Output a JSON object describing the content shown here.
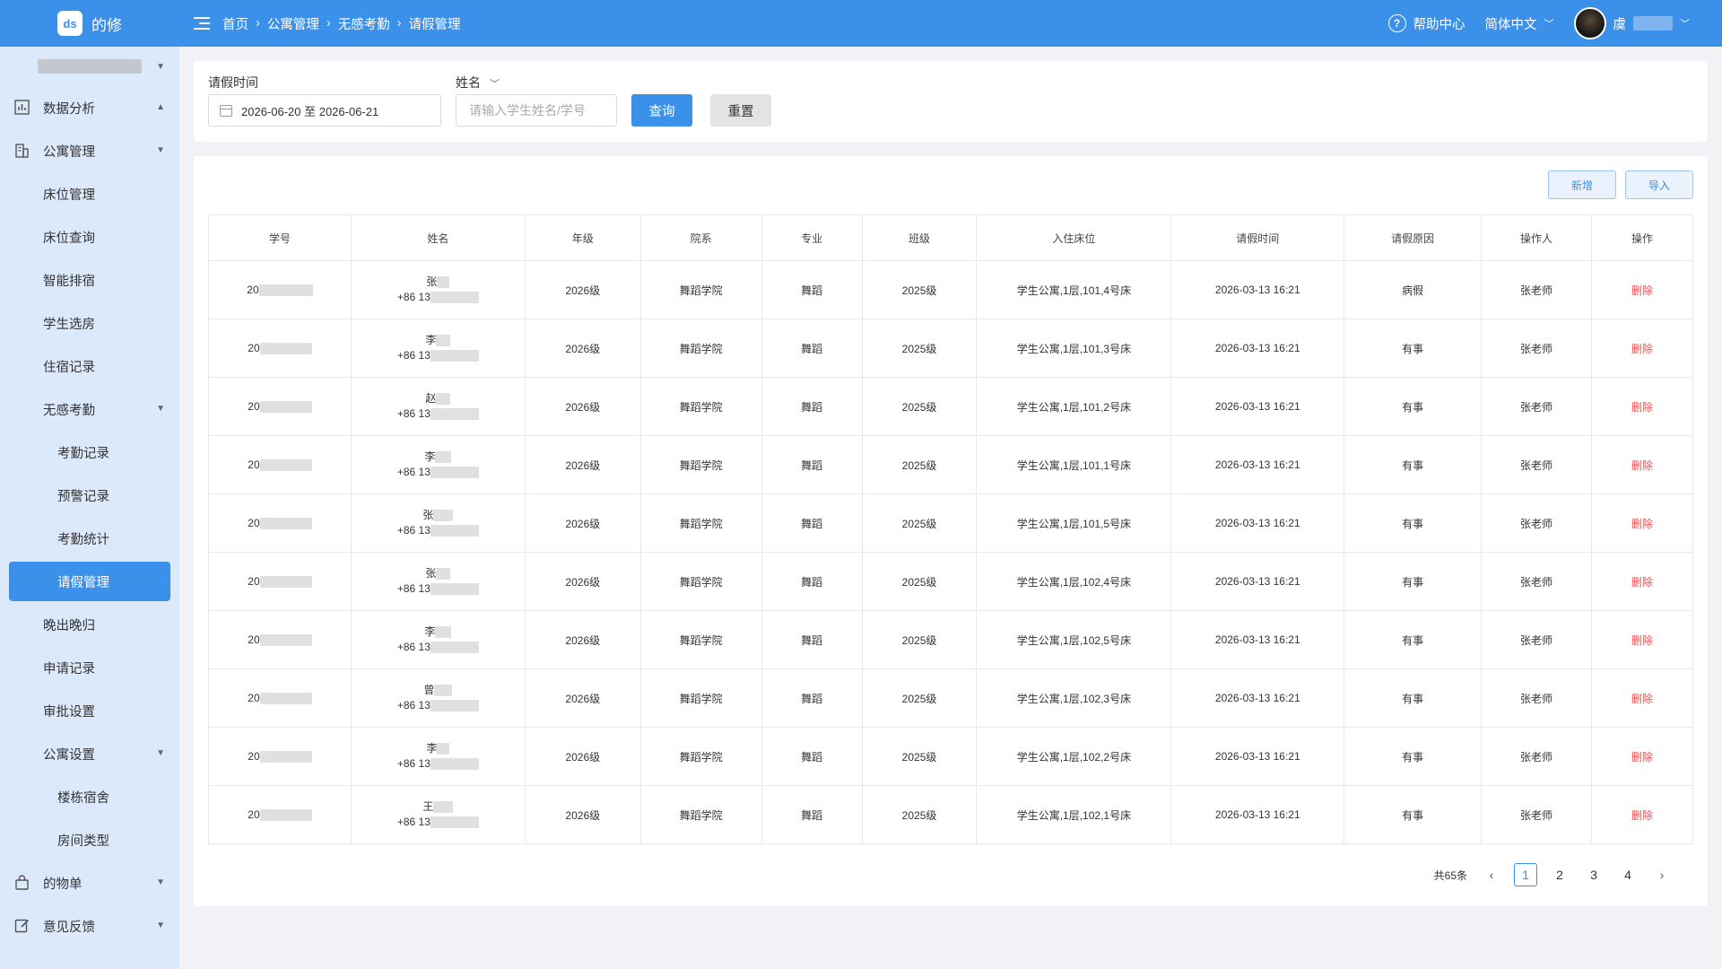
{
  "app": {
    "name": "的修",
    "logo_text": "ds"
  },
  "sidebar": {
    "items": [
      {
        "label": "数据分析",
        "icon": "bar-chart-icon"
      },
      {
        "label": "公寓管理",
        "icon": "building-icon"
      },
      {
        "label": "床位管理"
      },
      {
        "label": "床位查询"
      },
      {
        "label": "智能排宿"
      },
      {
        "label": "学生选房"
      },
      {
        "label": "住宿记录"
      },
      {
        "label": "无感考勤"
      },
      {
        "label": "考勤记录"
      },
      {
        "label": "预警记录"
      },
      {
        "label": "考勤统计"
      },
      {
        "label": "请假管理"
      },
      {
        "label": "晚出晚归"
      },
      {
        "label": "申请记录"
      },
      {
        "label": "审批设置"
      },
      {
        "label": "公寓设置"
      },
      {
        "label": "楼栋宿舍"
      },
      {
        "label": "房间类型"
      },
      {
        "label": "的物单",
        "icon": "bag-icon"
      },
      {
        "label": "意见反馈",
        "icon": "edit-icon"
      }
    ]
  },
  "header": {
    "breadcrumb": [
      "首页",
      "公寓管理",
      "无感考勤",
      "请假管理"
    ],
    "help": "帮助中心",
    "language": "简体中文",
    "user_initial": "虞"
  },
  "filter": {
    "date_label": "请假时间",
    "date_value": "2026-06-20 至 2026-06-21",
    "name_label": "姓名",
    "name_placeholder": "请输入学生姓名/学号",
    "search_button": "查询",
    "reset_button": "重置"
  },
  "toolbar": {
    "add_button": "新增",
    "import_button": "导入"
  },
  "table": {
    "columns": [
      "学号",
      "姓名",
      "年级",
      "院系",
      "专业",
      "班级",
      "入住床位",
      "请假时间",
      "请假原因",
      "操作人",
      "操作"
    ],
    "rows": [
      {
        "id_prefix": "20",
        "surname": "张",
        "phone_prefix": "+86 13",
        "grade": "2026级",
        "dept": "舞蹈学院",
        "major": "舞蹈",
        "cls": "2025级",
        "bed": "学生公寓,1层,101,4号床",
        "time": "2026-03-13 16:21",
        "reason": "病假",
        "operator": "张老师",
        "action": "删除"
      },
      {
        "id_prefix": "20",
        "surname": "李",
        "phone_prefix": "+86 13",
        "grade": "2026级",
        "dept": "舞蹈学院",
        "major": "舞蹈",
        "cls": "2025级",
        "bed": "学生公寓,1层,101,3号床",
        "time": "2026-03-13 16:21",
        "reason": "有事",
        "operator": "张老师",
        "action": "删除"
      },
      {
        "id_prefix": "20",
        "surname": "赵",
        "phone_prefix": "+86 13",
        "grade": "2026级",
        "dept": "舞蹈学院",
        "major": "舞蹈",
        "cls": "2025级",
        "bed": "学生公寓,1层,101,2号床",
        "time": "2026-03-13 16:21",
        "reason": "有事",
        "operator": "张老师",
        "action": "删除"
      },
      {
        "id_prefix": "20",
        "surname": "李",
        "phone_prefix": "+86 13",
        "grade": "2026级",
        "dept": "舞蹈学院",
        "major": "舞蹈",
        "cls": "2025级",
        "bed": "学生公寓,1层,101,1号床",
        "time": "2026-03-13 16:21",
        "reason": "有事",
        "operator": "张老师",
        "action": "删除"
      },
      {
        "id_prefix": "20",
        "surname": "张",
        "phone_prefix": "+86 13",
        "grade": "2026级",
        "dept": "舞蹈学院",
        "major": "舞蹈",
        "cls": "2025级",
        "bed": "学生公寓,1层,101,5号床",
        "time": "2026-03-13 16:21",
        "reason": "有事",
        "operator": "张老师",
        "action": "删除"
      },
      {
        "id_prefix": "20",
        "surname": "张",
        "phone_prefix": "+86 13",
        "grade": "2026级",
        "dept": "舞蹈学院",
        "major": "舞蹈",
        "cls": "2025级",
        "bed": "学生公寓,1层,102,4号床",
        "time": "2026-03-13 16:21",
        "reason": "有事",
        "operator": "张老师",
        "action": "删除"
      },
      {
        "id_prefix": "20",
        "surname": "李",
        "phone_prefix": "+86 13",
        "grade": "2026级",
        "dept": "舞蹈学院",
        "major": "舞蹈",
        "cls": "2025级",
        "bed": "学生公寓,1层,102,5号床",
        "time": "2026-03-13 16:21",
        "reason": "有事",
        "operator": "张老师",
        "action": "删除"
      },
      {
        "id_prefix": "20",
        "surname": "曾",
        "phone_prefix": "+86 13",
        "grade": "2026级",
        "dept": "舞蹈学院",
        "major": "舞蹈",
        "cls": "2025级",
        "bed": "学生公寓,1层,102,3号床",
        "time": "2026-03-13 16:21",
        "reason": "有事",
        "operator": "张老师",
        "action": "删除"
      },
      {
        "id_prefix": "20",
        "surname": "李",
        "phone_prefix": "+86 13",
        "grade": "2026级",
        "dept": "舞蹈学院",
        "major": "舞蹈",
        "cls": "2025级",
        "bed": "学生公寓,1层,102,2号床",
        "time": "2026-03-13 16:21",
        "reason": "有事",
        "operator": "张老师",
        "action": "删除"
      },
      {
        "id_prefix": "20",
        "surname": "王",
        "phone_prefix": "+86 13",
        "grade": "2026级",
        "dept": "舞蹈学院",
        "major": "舞蹈",
        "cls": "2025级",
        "bed": "学生公寓,1层,102,1号床",
        "time": "2026-03-13 16:21",
        "reason": "有事",
        "operator": "张老师",
        "action": "删除"
      }
    ]
  },
  "pagination": {
    "total": "共65条",
    "pages": [
      "1",
      "2",
      "3",
      "4"
    ],
    "current": "1"
  },
  "colors": {
    "primary": "#3b90ea",
    "sidebar_bg": "#dbe9fb",
    "danger": "#ef4f4f"
  }
}
